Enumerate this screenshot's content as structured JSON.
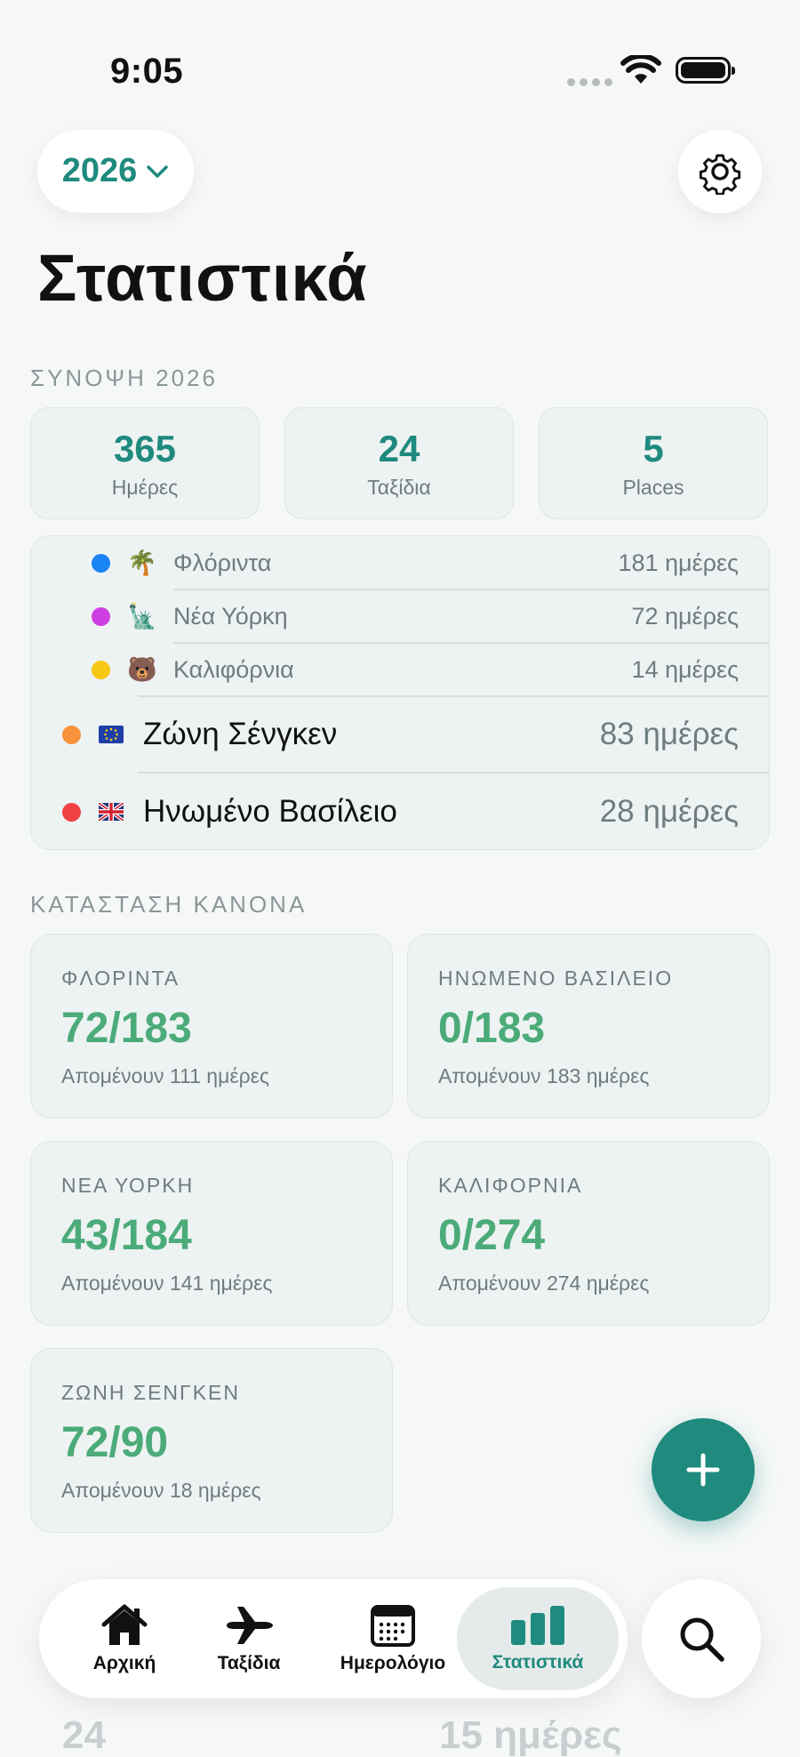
{
  "status_bar": {
    "time": "9:05"
  },
  "header": {
    "year": "2026",
    "title": "Στατιστικά"
  },
  "summary": {
    "label": "ΣΥΝΟΨΗ 2026",
    "boxes": [
      {
        "value": "365",
        "label": "Ημέρες"
      },
      {
        "value": "24",
        "label": "Ταξίδια"
      },
      {
        "value": "5",
        "label": "Places"
      }
    ]
  },
  "places": [
    {
      "name": "Φλόριντα",
      "days": "181 ημέρες",
      "dot_color": "#1a84f5",
      "flag": "🌴"
    },
    {
      "name": "Νέα Υόρκη",
      "days": "72 ημέρες",
      "dot_color": "#cc3fe0",
      "flag": "🗽"
    },
    {
      "name": "Καλιφόρνια",
      "days": "14 ημέρες",
      "dot_color": "#f6c814",
      "flag": "🐻"
    },
    {
      "name": "Ζώνη Σένγκεν",
      "days": "83 ημέρες",
      "dot_color": "#f7913a",
      "flag": "eu-flag"
    },
    {
      "name": "Ηνωμένο Βασίλειο",
      "days": "28 ημέρες",
      "dot_color": "#ef4044",
      "flag": "uk-flag"
    }
  ],
  "rules": {
    "label": "ΚΑΤΑΣΤΑΣΗ ΚΑΝΟΝΑ",
    "cards": [
      {
        "name": "ΦΛΟΡΙΝΤΑ",
        "value": "72/183",
        "remaining": "Απομένουν 111 ημέρες"
      },
      {
        "name": "ΗΝΩΜΕΝΟ ΒΑΣΙΛΕΙΟ",
        "value": "0/183",
        "remaining": "Απομένουν 183 ημέρες"
      },
      {
        "name": "ΝΕΑ ΥΟΡΚΗ",
        "value": "43/184",
        "remaining": "Απομένουν 141 ημέρες"
      },
      {
        "name": "ΚΑΛΙΦΟΡΝΙΑ",
        "value": "0/274",
        "remaining": "Απομένουν 274 ημέρες"
      },
      {
        "name": "ΖΩΝΗ ΣΕΝΓΚΕΝ",
        "value": "72/90",
        "remaining": "Απομένουν 18 ημέρες"
      }
    ]
  },
  "faded": {
    "left_value": "24",
    "right_value": "15 ημέρες"
  },
  "tabs": [
    {
      "label": "Αρχική",
      "icon": "house-icon"
    },
    {
      "label": "Ταξίδια",
      "icon": "airplane-icon"
    },
    {
      "label": "Ημερολόγιο",
      "icon": "calendar-icon"
    },
    {
      "label": "Στατιστικά",
      "icon": "bar-chart-icon",
      "active": true
    }
  ],
  "colors": {
    "accent": "#1f8a7e",
    "rule_value": "#4bab79",
    "background": "#f6f8f8"
  }
}
